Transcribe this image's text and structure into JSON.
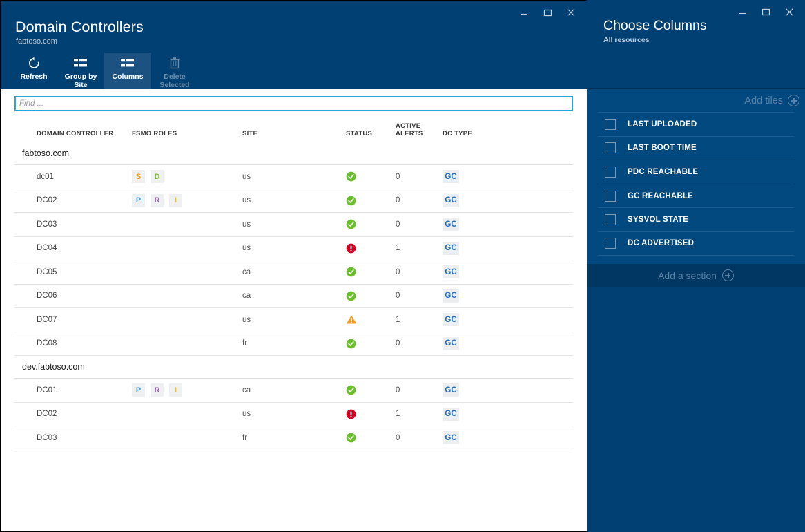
{
  "window": {
    "controls": [
      "minimize-icon",
      "maximize-icon",
      "close-icon"
    ]
  },
  "main": {
    "title": "Domain Controllers",
    "subtitle": "fabtoso.com",
    "toolbar": [
      {
        "label": "Refresh",
        "icon": "refresh-icon",
        "state": "normal"
      },
      {
        "label": "Group by Site",
        "icon": "list-columns-icon",
        "state": "normal"
      },
      {
        "label": "Columns",
        "icon": "list-columns-icon",
        "state": "active"
      },
      {
        "label": "Delete Selected",
        "icon": "trash-icon",
        "state": "disabled"
      }
    ],
    "search": {
      "value": "",
      "placeholder": "Find ..."
    },
    "table": {
      "columns": [
        "DOMAIN CONTROLLER",
        "FSMO ROLES",
        "SITE",
        "STATUS",
        "ACTIVE ALERTS",
        "DC TYPE"
      ],
      "groups": [
        {
          "name": "fabtoso.com",
          "rows": [
            {
              "dc": "dc01",
              "fsmo": [
                "S",
                "D"
              ],
              "site": "us",
              "status": "ok",
              "alerts": "0",
              "type": "GC"
            },
            {
              "dc": "DC02",
              "fsmo": [
                "P",
                "R",
                "I"
              ],
              "site": "us",
              "status": "ok",
              "alerts": "0",
              "type": "GC"
            },
            {
              "dc": "DC03",
              "fsmo": [],
              "site": "us",
              "status": "ok",
              "alerts": "0",
              "type": "GC"
            },
            {
              "dc": "DC04",
              "fsmo": [],
              "site": "us",
              "status": "error",
              "alerts": "1",
              "type": "GC"
            },
            {
              "dc": "DC05",
              "fsmo": [],
              "site": "ca",
              "status": "ok",
              "alerts": "0",
              "type": "GC"
            },
            {
              "dc": "DC06",
              "fsmo": [],
              "site": "ca",
              "status": "ok",
              "alerts": "0",
              "type": "GC"
            },
            {
              "dc": "DC07",
              "fsmo": [],
              "site": "us",
              "status": "warning",
              "alerts": "1",
              "type": "GC"
            },
            {
              "dc": "DC08",
              "fsmo": [],
              "site": "fr",
              "status": "ok",
              "alerts": "0",
              "type": "GC"
            }
          ]
        },
        {
          "name": "dev.fabtoso.com",
          "rows": [
            {
              "dc": "DC01",
              "fsmo": [
                "P",
                "R",
                "I"
              ],
              "site": "ca",
              "status": "ok",
              "alerts": "0",
              "type": "GC"
            },
            {
              "dc": "DC02",
              "fsmo": [],
              "site": "us",
              "status": "error",
              "alerts": "1",
              "type": "GC"
            },
            {
              "dc": "DC03",
              "fsmo": [],
              "site": "fr",
              "status": "ok",
              "alerts": "0",
              "type": "GC"
            }
          ]
        }
      ]
    }
  },
  "side": {
    "title": "Choose Columns",
    "subtitle": "All resources",
    "add_tiles_label": "Add tiles",
    "add_section_label": "Add a section",
    "columns": [
      {
        "label": "LAST UPLOADED",
        "checked": false
      },
      {
        "label": "LAST BOOT TIME",
        "checked": false
      },
      {
        "label": "PDC REACHABLE",
        "checked": false
      },
      {
        "label": "GC REACHABLE",
        "checked": false
      },
      {
        "label": "SYSVOL STATE",
        "checked": false
      },
      {
        "label": "DC ADVERTISED",
        "checked": false
      }
    ]
  },
  "colors": {
    "header_blue": "#014073",
    "panel_blue": "#02497f",
    "active_tool": "#1b5282",
    "accent_cyan": "#25a7dd",
    "status_ok": "#6bbf2a",
    "status_error": "#d50021",
    "status_warning": "#f59a23",
    "gc_blue": "#1f6fc4"
  }
}
